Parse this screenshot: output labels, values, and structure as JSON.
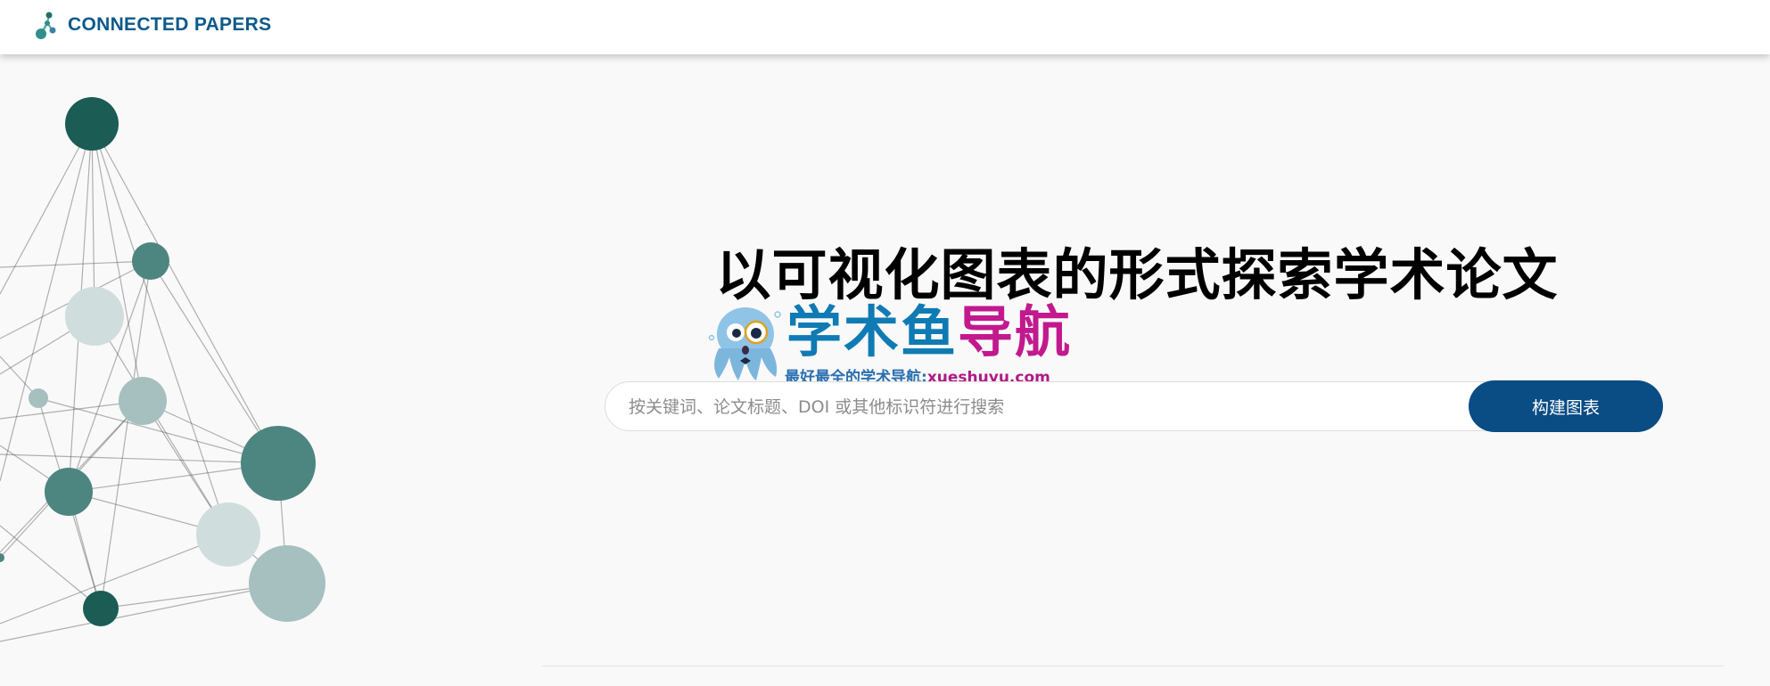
{
  "header": {
    "brand_name": "CONNECTED PAPERS",
    "logo_icon": "connected-papers-logo-icon"
  },
  "hero": {
    "headline": "以可视化图表的形式探索学术论文"
  },
  "watermark": {
    "title_part1": "学术鱼",
    "title_part2": "导航",
    "subtitle_prefix": "最好最全的学术导航:",
    "subtitle_site": "xueshuyu.com",
    "mascot_icon": "octopus-mascot-icon"
  },
  "search": {
    "placeholder": "按关键词、论文标题、DOI 或其他标识符进行搜索",
    "value": "",
    "button_label": "构建图表"
  },
  "colors": {
    "brand": "#0d5a8a",
    "button": "#0a4c84",
    "node_dark": "#1b5c55",
    "node_mid": "#4d8580",
    "node_light": "#a6bfbf",
    "node_pale": "#cfdddd"
  }
}
